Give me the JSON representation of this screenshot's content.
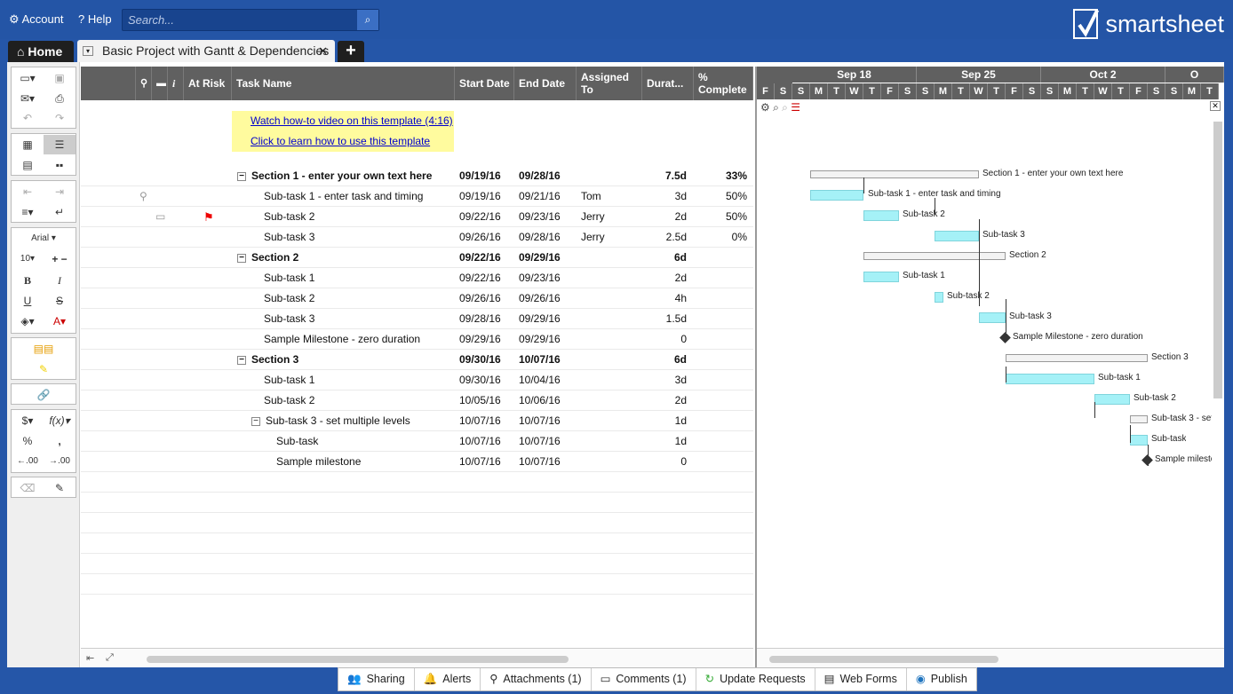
{
  "top": {
    "account": "Account",
    "help": "Help",
    "search_placeholder": "Search...",
    "brand": "smartsheet"
  },
  "tabs": {
    "home": "Home",
    "doc": "Basic Project with Gantt & Dependencies",
    "plus": "+"
  },
  "toolbar": {
    "font": "Arial",
    "size": "10",
    "bold": "B",
    "italic": "I",
    "underline": "U",
    "strike": "S",
    "dollar": "$",
    "fx": "f(x)",
    "percent": "%",
    "comma": ",",
    "dec_less": ".00",
    "dec_more": ".00"
  },
  "columns": {
    "at_risk": "At Risk",
    "task": "Task Name",
    "start": "Start Date",
    "end": "End Date",
    "assigned": "Assigned To",
    "duration": "Durat...",
    "complete": "% Complete",
    "info": "i"
  },
  "links": {
    "video": "Watch how-to video on this template (4:16)",
    "learn": "Click to learn how to use this template"
  },
  "rows": [
    {
      "task": "Section 1 - enter your own text here",
      "start": "09/19/16",
      "end": "09/28/16",
      "assigned": "",
      "duration": "7.5d",
      "complete": "33%"
    },
    {
      "task": "Sub-task 1 - enter task and timing",
      "start": "09/19/16",
      "end": "09/21/16",
      "assigned": "Tom",
      "duration": "3d",
      "complete": "50%"
    },
    {
      "task": "Sub-task 2",
      "start": "09/22/16",
      "end": "09/23/16",
      "assigned": "Jerry",
      "duration": "2d",
      "complete": "50%"
    },
    {
      "task": "Sub-task 3",
      "start": "09/26/16",
      "end": "09/28/16",
      "assigned": "Jerry",
      "duration": "2.5d",
      "complete": "0%"
    },
    {
      "task": "Section 2",
      "start": "09/22/16",
      "end": "09/29/16",
      "assigned": "",
      "duration": "6d",
      "complete": ""
    },
    {
      "task": "Sub-task 1",
      "start": "09/22/16",
      "end": "09/23/16",
      "assigned": "",
      "duration": "2d",
      "complete": ""
    },
    {
      "task": "Sub-task 2",
      "start": "09/26/16",
      "end": "09/26/16",
      "assigned": "",
      "duration": "4h",
      "complete": ""
    },
    {
      "task": "Sub-task 3",
      "start": "09/28/16",
      "end": "09/29/16",
      "assigned": "",
      "duration": "1.5d",
      "complete": ""
    },
    {
      "task": "Sample Milestone - zero duration",
      "start": "09/29/16",
      "end": "09/29/16",
      "assigned": "",
      "duration": "0",
      "complete": ""
    },
    {
      "task": "Section 3",
      "start": "09/30/16",
      "end": "10/07/16",
      "assigned": "",
      "duration": "6d",
      "complete": ""
    },
    {
      "task": "Sub-task 1",
      "start": "09/30/16",
      "end": "10/04/16",
      "assigned": "",
      "duration": "3d",
      "complete": ""
    },
    {
      "task": "Sub-task 2",
      "start": "10/05/16",
      "end": "10/06/16",
      "assigned": "",
      "duration": "2d",
      "complete": ""
    },
    {
      "task": "Sub-task 3 - set multiple levels",
      "start": "10/07/16",
      "end": "10/07/16",
      "assigned": "",
      "duration": "1d",
      "complete": ""
    },
    {
      "task": "Sub-task",
      "start": "10/07/16",
      "end": "10/07/16",
      "assigned": "",
      "duration": "1d",
      "complete": ""
    },
    {
      "task": "Sample milestone",
      "start": "10/07/16",
      "end": "10/07/16",
      "assigned": "",
      "duration": "0",
      "complete": ""
    }
  ],
  "gantt": {
    "months": [
      "Sep 18",
      "Sep 25",
      "Oct 2",
      "O"
    ],
    "days": [
      "F",
      "S",
      "S",
      "M",
      "T",
      "W",
      "T",
      "F",
      "S",
      "S",
      "M",
      "T",
      "W",
      "T",
      "F",
      "S",
      "S",
      "M",
      "T",
      "W",
      "T",
      "F",
      "S",
      "S",
      "M",
      "T"
    ],
    "labels": [
      "Section 1 - enter your own text here",
      "Sub-task 1 - enter task and timing",
      "Sub-task 2",
      "Sub-task 3",
      "Section 2",
      "Sub-task 1",
      "Sub-task 2",
      "Sub-task 3",
      "Sample Milestone - zero duration",
      "Section 3",
      "Sub-task 1",
      "Sub-task 2",
      "Sub-task 3 - set",
      "Sub-task",
      "Sample milesto"
    ]
  },
  "bottom": {
    "sharing": "Sharing",
    "alerts": "Alerts",
    "attachments": "Attachments (1)",
    "comments": "Comments (1)",
    "update": "Update Requests",
    "webforms": "Web Forms",
    "publish": "Publish"
  }
}
